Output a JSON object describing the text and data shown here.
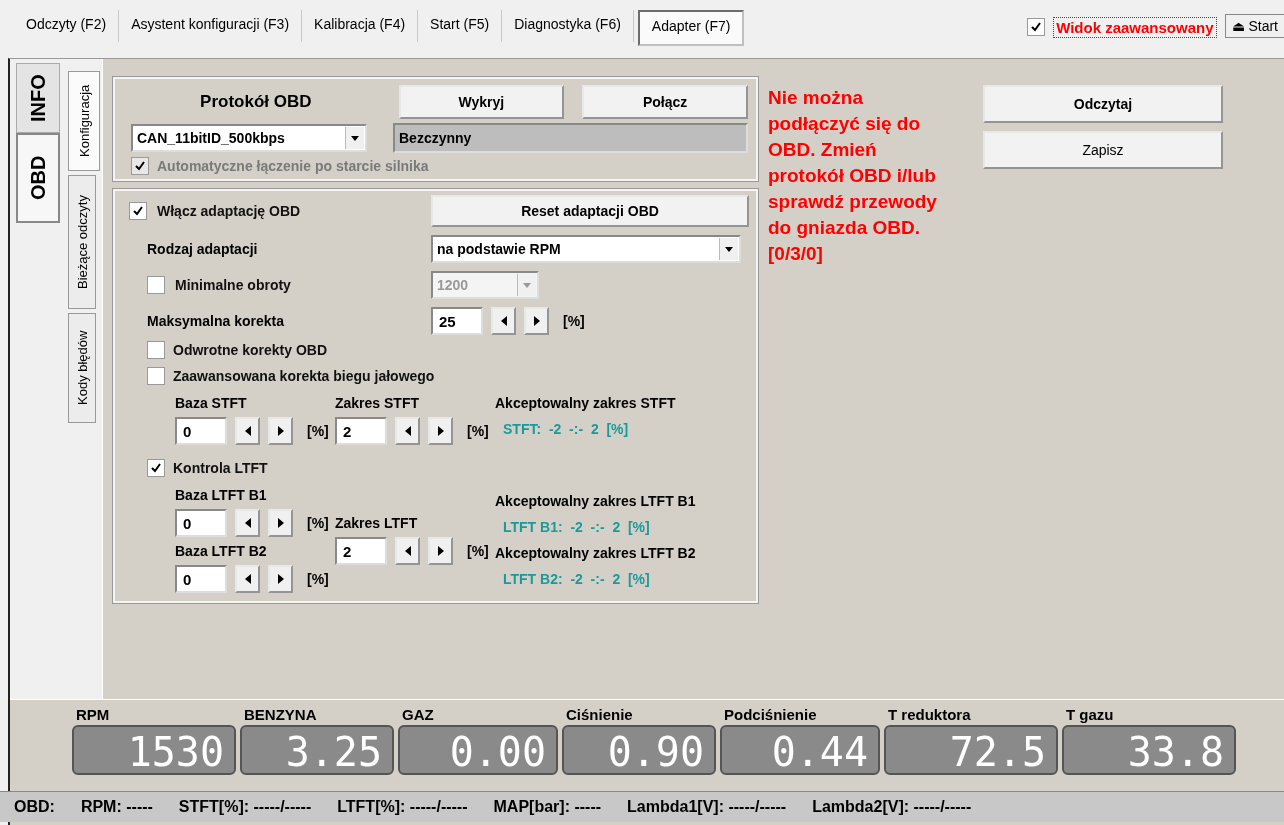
{
  "top_tabs": [
    {
      "label": "Odczyty (F2)",
      "selected": false
    },
    {
      "label": "Asystent konfiguracji (F3)",
      "selected": false
    },
    {
      "label": "Kalibracja (F4)",
      "selected": false
    },
    {
      "label": "Start (F5)",
      "selected": false
    },
    {
      "label": "Diagnostyka (F6)",
      "selected": false
    },
    {
      "label": "Adapter (F7)",
      "selected": true
    }
  ],
  "advanced_view": {
    "label": "Widok zaawansowany",
    "checked": true
  },
  "start_button": {
    "icon": "⏏",
    "label": "Start"
  },
  "side_tabs": [
    {
      "label": "INFO",
      "selected": false
    },
    {
      "label": "OBD",
      "selected": true
    }
  ],
  "sub_tabs": [
    {
      "label": "Konfiguracja",
      "selected": true
    },
    {
      "label": "Bieżące odczyty",
      "selected": false
    },
    {
      "label": "Kody błędów",
      "selected": false
    }
  ],
  "protocol": {
    "title": "Protokół OBD",
    "value": "CAN_11bitID_500kbps",
    "detect": "Wykryj",
    "connect": "Połącz",
    "status": "Bezczynny",
    "auto_connect": {
      "label": "Automatyczne łączenie po starcie silnika",
      "checked": true,
      "disabled": true
    }
  },
  "adaptation": {
    "enable": {
      "label": "Włącz adaptację OBD",
      "checked": true
    },
    "reset": "Reset adaptacji OBD",
    "type_label": "Rodzaj adaptacji",
    "type_value": "na podstawie RPM",
    "min_rpm": {
      "label": "Minimalne obroty",
      "checked": false,
      "value": "1200",
      "disabled": true
    },
    "max_correction": {
      "label": "Maksymalna korekta",
      "value": "25",
      "unit": "[%]"
    },
    "reverse": {
      "label": "Odwrotne korekty OBD",
      "checked": false
    },
    "idle": {
      "label": "Zaawansowana korekta biegu jałowego",
      "checked": false
    },
    "stft_base": {
      "label": "Baza STFT",
      "value": "0",
      "unit": "[%]"
    },
    "stft_range": {
      "label": "Zakres STFT",
      "value": "2",
      "unit": "[%]"
    },
    "stft_accept": {
      "label": "Akceptowalny zakres STFT",
      "value": "STFT:  -2  -:-  2  [%]"
    },
    "ltft": {
      "label": "Kontrola LTFT",
      "checked": true
    },
    "ltft_base_b1": {
      "label": "Baza LTFT B1",
      "value": "0",
      "unit": "[%]"
    },
    "ltft_base_b2": {
      "label": "Baza LTFT B2",
      "value": "0",
      "unit": "[%]"
    },
    "ltft_range": {
      "label": "Zakres LTFT",
      "value": "2",
      "unit": "[%]"
    },
    "ltft_accept_b1": {
      "label": "Akceptowalny zakres LTFT B1",
      "value": "LTFT B1:  -2  -:-  2  [%]"
    },
    "ltft_accept_b2": {
      "label": "Akceptowalny zakres LTFT B2",
      "value": "LTFT B2:  -2  -:-  2  [%]"
    }
  },
  "message": "Nie można podłączyć się do OBD. Zmień protokół OBD i/lub sprawdź przewody do gniazda OBD. [0/3/0]",
  "buttons": [
    "Odczytaj",
    "Zapisz"
  ],
  "gauges": [
    {
      "label": "RPM",
      "value": "1530"
    },
    {
      "label": "BENZYNA",
      "value": "3.25"
    },
    {
      "label": "GAZ",
      "value": "0.00"
    },
    {
      "label": "Ciśnienie",
      "value": "0.90"
    },
    {
      "label": "Podciśnienie",
      "value": "0.44"
    },
    {
      "label": "T reduktora",
      "value": "72.5"
    },
    {
      "label": "T gazu",
      "value": "33.8"
    }
  ],
  "status_bar": [
    "OBD:",
    "RPM: -----",
    "STFT[%]: -----/-----",
    "LTFT[%]: -----/-----",
    "MAP[bar]: -----",
    "Lambda1[V]: -----/-----",
    "Lambda2[V]: -----/-----"
  ]
}
